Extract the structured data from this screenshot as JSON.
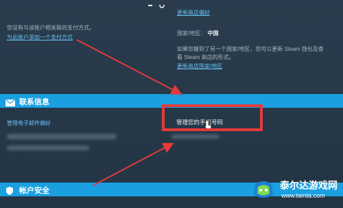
{
  "payment": {
    "no_method_text": "您没有与该账户相关联的支付方式。",
    "add_method_link": "为此账户添加一个支付方式"
  },
  "store": {
    "store_prefs_link_top": "更新商店偏好",
    "country_label": "国家/地区：",
    "country_value": "中国",
    "move_notice_line1": "如果您搬到了另一个国家/地区，您可以更新 Steam 钱包及查",
    "move_notice_line2": "看 Steam 商店的形式。",
    "update_country_link": "更新商店国家/地区"
  },
  "contact": {
    "section_title": "联系信息",
    "manage_email_prefs_link": "管理电子邮件偏好",
    "manage_phone_link": "管理您的手机号码"
  },
  "security": {
    "section_title": "帐户安全"
  },
  "colors": {
    "accent": "#1a9fe0",
    "highlight": "#e53a3a",
    "link": "#66c0f4"
  },
  "watermark": {
    "brand": "泰尔达游戏网",
    "url": "www.tairda.com"
  }
}
